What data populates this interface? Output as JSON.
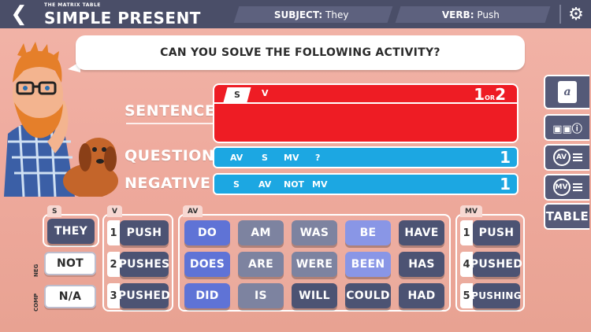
{
  "header": {
    "subtitle": "THE MATRIX TABLE",
    "title": "SIMPLE PRESENT",
    "subject_label": "SUBJECT:",
    "subject_value": "They",
    "verb_label": "VERB:",
    "verb_value": "Push"
  },
  "prompt": "CAN YOU SOLVE THE FOLLOWING ACTIVITY?",
  "rows": {
    "sentence": {
      "label": "SENTENCE",
      "tokens": [
        "S",
        "V"
      ],
      "count_main": "1",
      "count_small": "OR",
      "count_alt": "2"
    },
    "question": {
      "label": "QUESTION",
      "tokens": [
        "AV",
        "S",
        "MV",
        "?"
      ],
      "count": "1"
    },
    "negative": {
      "label": "NEGATIVE",
      "tokens": [
        "S",
        "AV",
        "NOT",
        "MV"
      ],
      "count": "1"
    }
  },
  "sidebar": {
    "table_label": "TABLE",
    "av_label": "AV",
    "mv_label": "MV",
    "notebook_label": "a"
  },
  "panels": {
    "s": {
      "tab": "S",
      "items": [
        "THEY"
      ]
    },
    "neg": {
      "side": "NEG",
      "items": [
        "NOT"
      ]
    },
    "comp": {
      "side": "COMP",
      "items": [
        "N/A"
      ]
    },
    "v": {
      "tab": "V",
      "numbers": [
        "1",
        "2",
        "3"
      ],
      "items": [
        "PUSH",
        "PUSHES",
        "PUSHED"
      ]
    },
    "av": {
      "tab": "AV",
      "rows": [
        [
          "DO",
          "AM",
          "WAS",
          "BE",
          "HAVE"
        ],
        [
          "DOES",
          "ARE",
          "WERE",
          "BEEN",
          "HAS"
        ],
        [
          "DID",
          "IS",
          "WILL",
          "COULD",
          "HAD"
        ]
      ]
    },
    "mv": {
      "tab": "MV",
      "numbers": [
        "1",
        "4",
        "5"
      ],
      "items": [
        "PUSH",
        "PUSHED",
        "PUSHING"
      ]
    }
  },
  "colors": {
    "red": "#ee1c24",
    "blue": "#1ca7e2",
    "bar": "#4a4e68"
  }
}
